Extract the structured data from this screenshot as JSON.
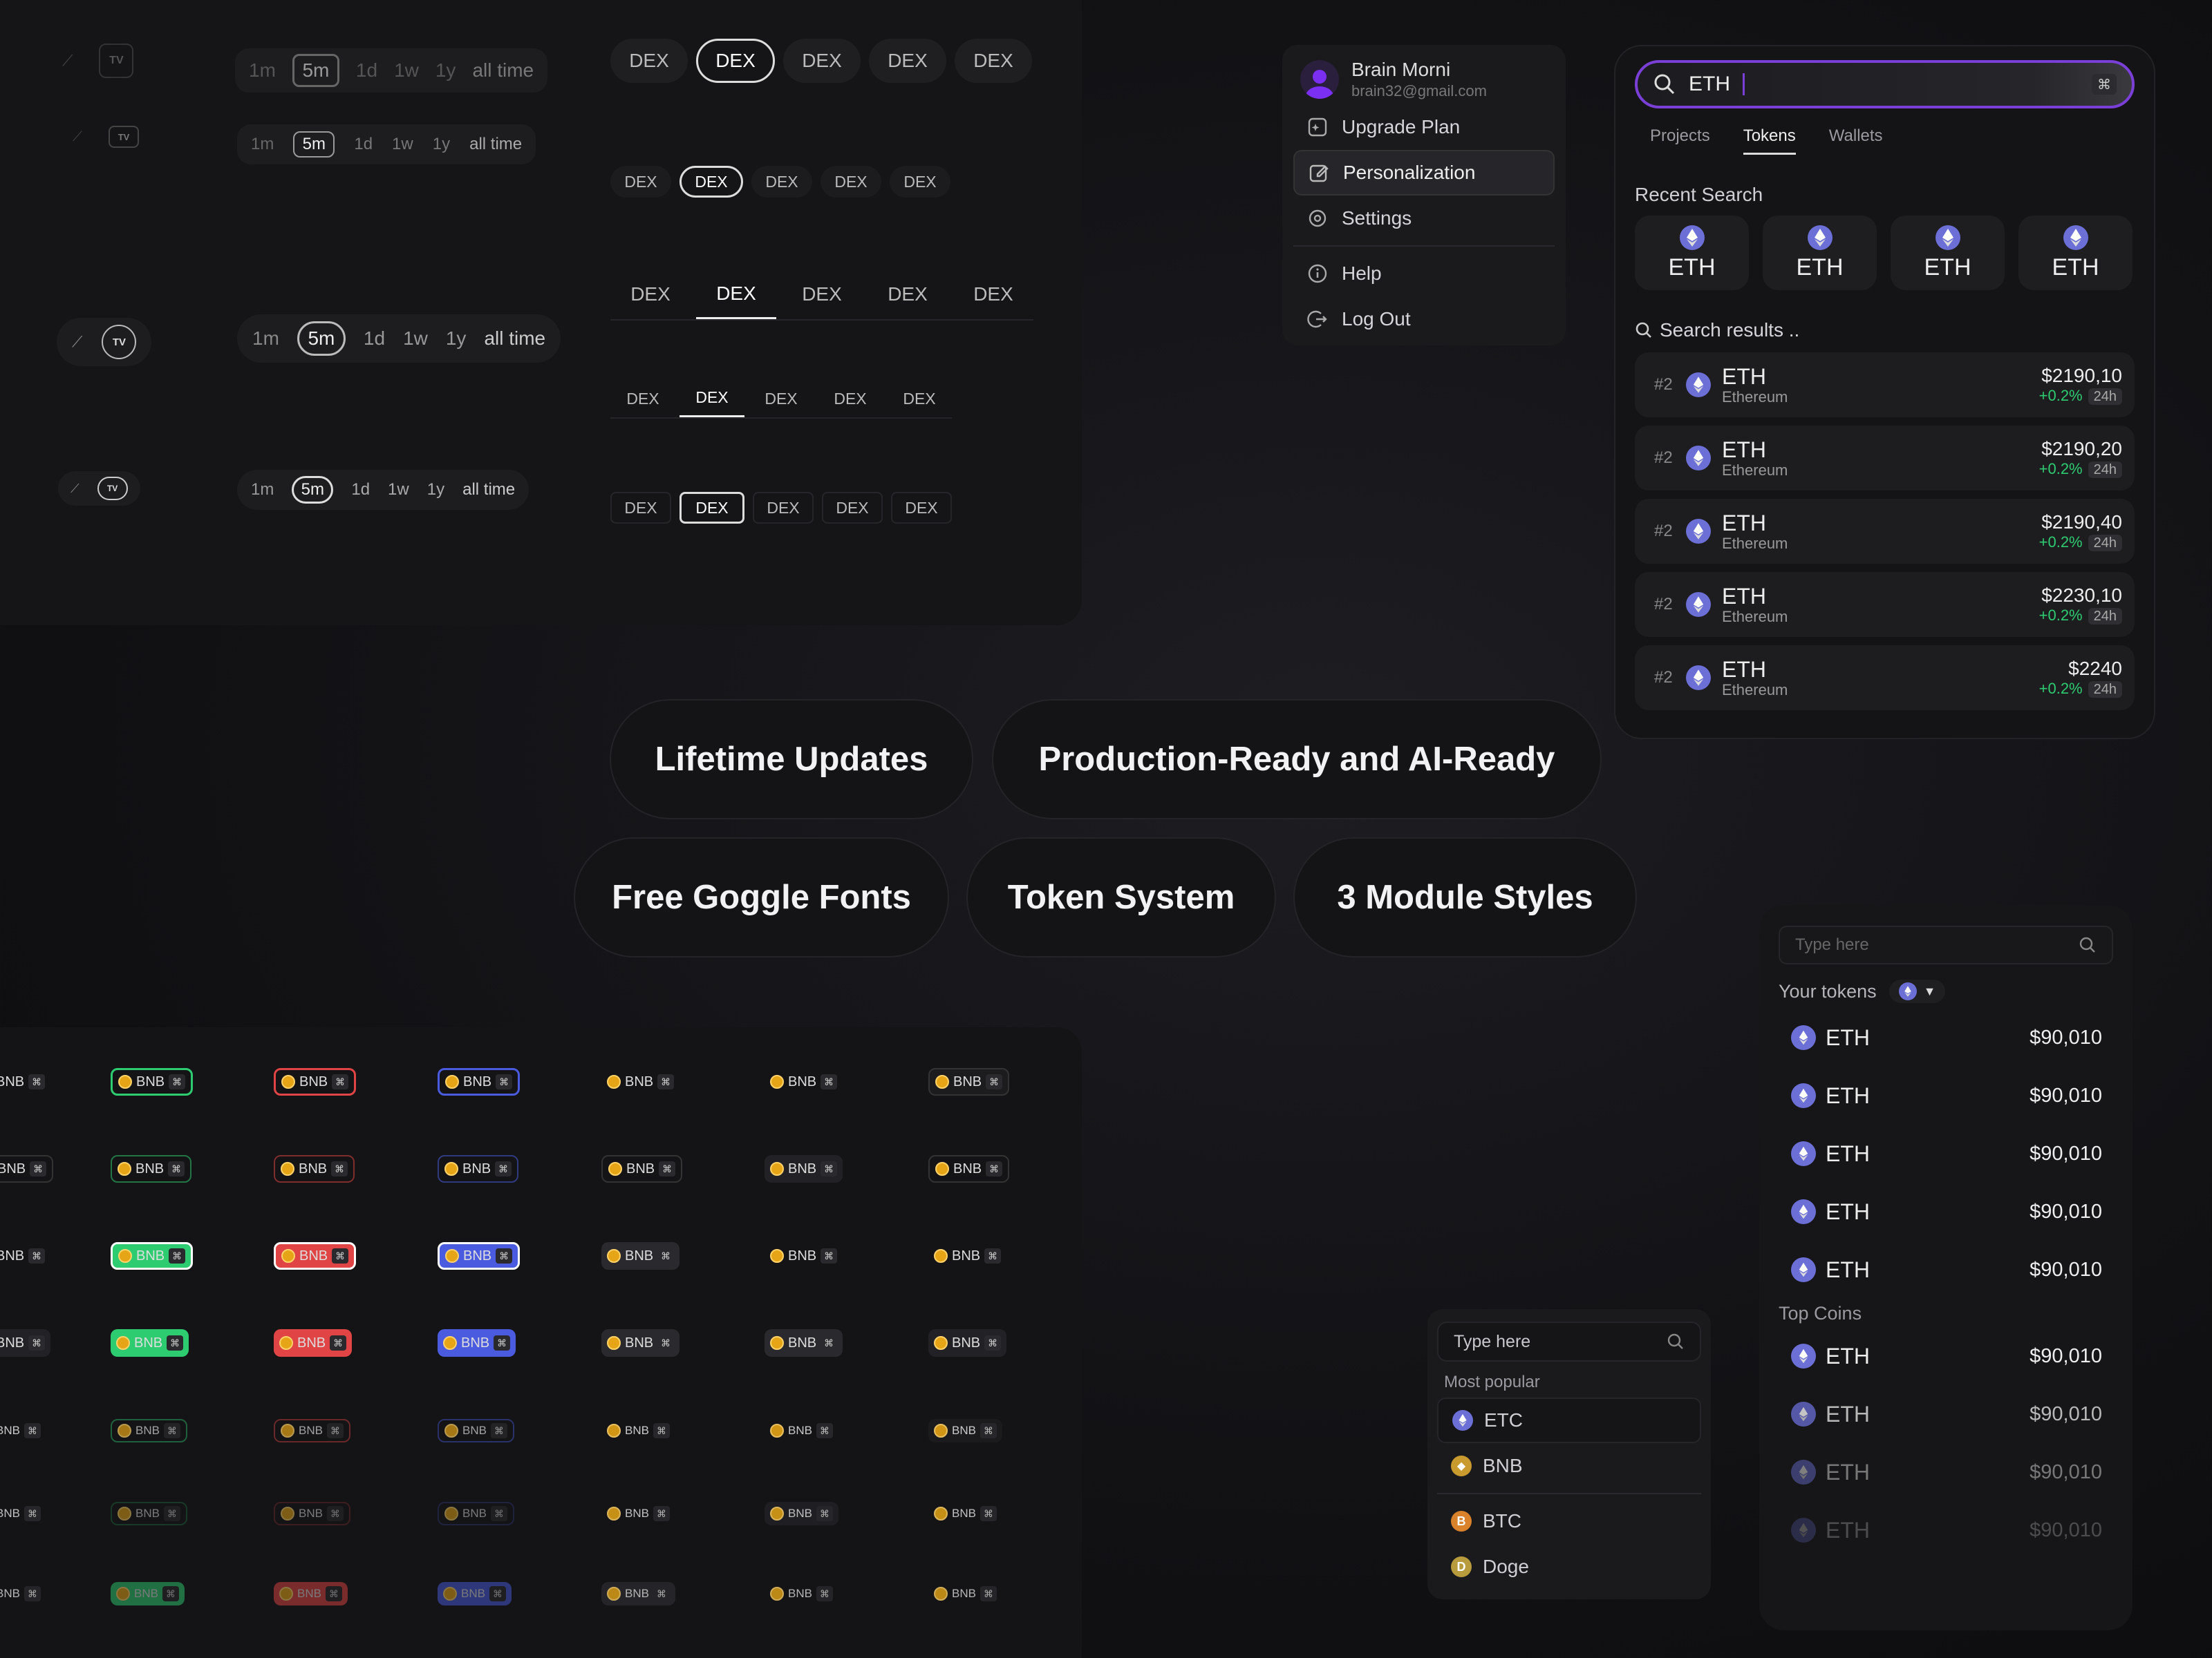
{
  "timeframes": {
    "options": [
      "1m",
      "5m",
      "1d",
      "1w",
      "1y",
      "all time"
    ],
    "active": "5m"
  },
  "dex": {
    "options": [
      "DEX",
      "DEX",
      "DEX",
      "DEX",
      "DEX"
    ],
    "active_index": 1
  },
  "user_menu": {
    "name": "Brain Morni",
    "email": "brain32@gmail.com",
    "items": [
      {
        "label": "Upgrade Plan",
        "icon": "sparkle-icon"
      },
      {
        "label": "Personalization",
        "icon": "edit-icon",
        "active": true
      },
      {
        "label": "Settings",
        "icon": "gear-icon"
      },
      {
        "label": "Help",
        "icon": "info-icon"
      },
      {
        "label": "Log Out",
        "icon": "logout-icon"
      }
    ]
  },
  "search": {
    "query": "ETH",
    "shortcut": "⌘",
    "tabs": [
      "Projects",
      "Tokens",
      "Wallets"
    ],
    "active_tab": "Tokens",
    "recent_title": "Recent Search",
    "recent": [
      "ETH",
      "ETH",
      "ETH",
      "ETH"
    ],
    "results_title": "Search results ..",
    "results": [
      {
        "rank": "#2",
        "symbol": "ETH",
        "name": "Ethereum",
        "price": "$2190,10",
        "change": "+0.2%",
        "period": "24h"
      },
      {
        "rank": "#2",
        "symbol": "ETH",
        "name": "Ethereum",
        "price": "$2190,20",
        "change": "+0.2%",
        "period": "24h"
      },
      {
        "rank": "#2",
        "symbol": "ETH",
        "name": "Ethereum",
        "price": "$2190,40",
        "change": "+0.2%",
        "period": "24h"
      },
      {
        "rank": "#2",
        "symbol": "ETH",
        "name": "Ethereum",
        "price": "$2230,10",
        "change": "+0.2%",
        "period": "24h"
      },
      {
        "rank": "#2",
        "symbol": "ETH",
        "name": "Ethereum",
        "price": "$2240",
        "change": "+0.2%",
        "period": "24h"
      }
    ]
  },
  "features": [
    "Lifetime Updates",
    "Production-Ready and AI-Ready",
    "Free Goggle Fonts",
    "Token System",
    "3 Module Styles"
  ],
  "badges": {
    "label": "BNB",
    "kbd": "⌘"
  },
  "popular": {
    "placeholder": "Type here",
    "title": "Most popular",
    "items": [
      {
        "label": "ETC",
        "color": "#6b6fd6"
      },
      {
        "label": "BNB",
        "color": "#c99a2e"
      },
      {
        "label": "BTC",
        "color": "#d9822b"
      },
      {
        "label": "Doge",
        "color": "#b89b3c"
      }
    ]
  },
  "tokens": {
    "placeholder": "Type here",
    "your_title": "Your tokens",
    "your": [
      {
        "symbol": "ETH",
        "value": "$90,010"
      },
      {
        "symbol": "ETH",
        "value": "$90,010"
      },
      {
        "symbol": "ETH",
        "value": "$90,010"
      },
      {
        "symbol": "ETH",
        "value": "$90,010"
      },
      {
        "symbol": "ETH",
        "value": "$90,010"
      }
    ],
    "top_title": "Top Coins",
    "top": [
      {
        "symbol": "ETH",
        "value": "$90,010"
      },
      {
        "symbol": "ETH",
        "value": "$90,010"
      },
      {
        "symbol": "ETH",
        "value": "$90,010"
      },
      {
        "symbol": "ETH",
        "value": "$90,010"
      }
    ]
  },
  "colors": {
    "accent": "#7a3fd6",
    "green": "#2ecc71",
    "red": "#e04444",
    "blue": "#4a5be0",
    "eth": "#6b6fd6",
    "bnb": "#e6a516"
  }
}
